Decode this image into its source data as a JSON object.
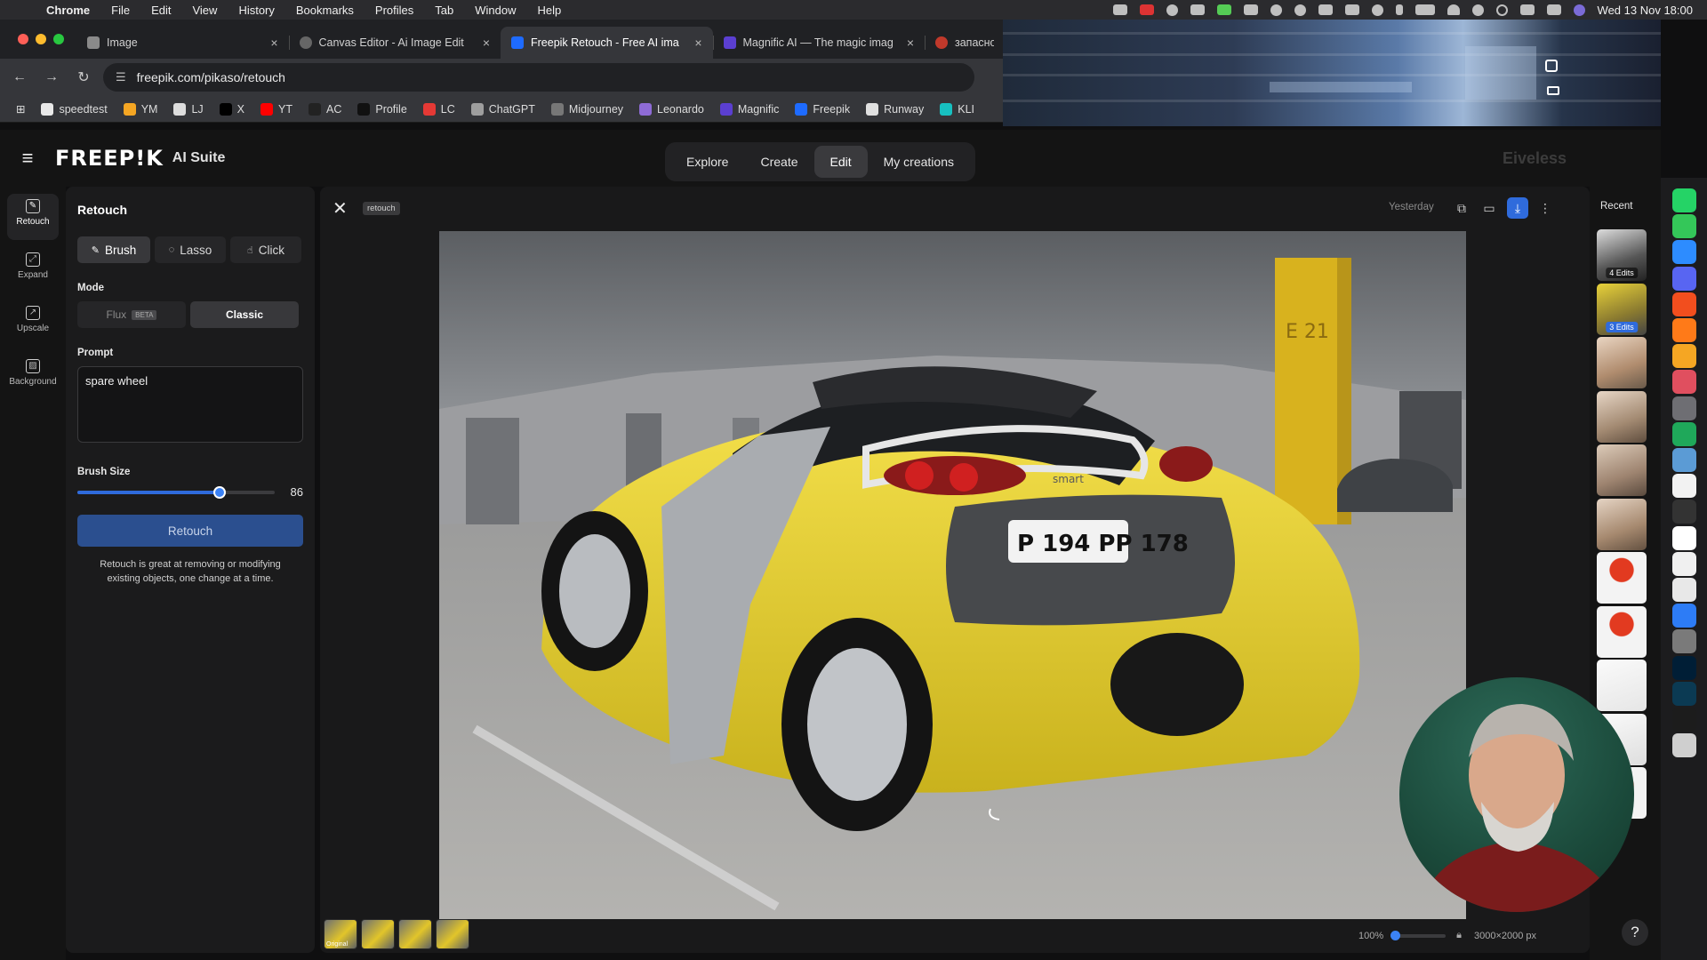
{
  "menubar": {
    "app": "Chrome",
    "items": [
      "File",
      "Edit",
      "View",
      "History",
      "Bookmarks",
      "Profiles",
      "Tab",
      "Window",
      "Help"
    ],
    "clock": "Wed 13 Nov 18:00"
  },
  "tabs": [
    {
      "title": "Image",
      "close": "×",
      "active": false
    },
    {
      "title": "Canvas Editor - Ai Image Edit",
      "close": "×",
      "active": false
    },
    {
      "title": "Freepik Retouch - Free AI ima",
      "close": "×",
      "active": true
    },
    {
      "title": "Magnific AI — The magic imag",
      "close": "×",
      "active": false
    },
    {
      "title": "запасное",
      "close": "",
      "active": false
    }
  ],
  "address": {
    "url": "freepik.com/pikaso/retouch"
  },
  "bookmarks": [
    {
      "label": "speedtest",
      "color": "#e8e8e8"
    },
    {
      "label": "YM",
      "color": "#f5a623"
    },
    {
      "label": "LJ",
      "color": "#dddddd"
    },
    {
      "label": "X",
      "color": "#000000"
    },
    {
      "label": "YT",
      "color": "#ff0000"
    },
    {
      "label": "AC",
      "color": "#222222"
    },
    {
      "label": "Profile",
      "color": "#111111"
    },
    {
      "label": "LC",
      "color": "#e53935"
    },
    {
      "label": "ChatGPT",
      "color": "#9e9e9e"
    },
    {
      "label": "Midjourney",
      "color": "#777777"
    },
    {
      "label": "Leonardo",
      "color": "#8e6bd6"
    },
    {
      "label": "Magnific",
      "color": "#5b3fd1"
    },
    {
      "label": "Freepik",
      "color": "#1e6bff"
    },
    {
      "label": "Runway",
      "color": "#e0e0e0"
    },
    {
      "label": "KLI",
      "color": "#17c0c0"
    }
  ],
  "header": {
    "logo": "FREEP!K",
    "suite": "AI Suite",
    "nav": [
      {
        "label": "Explore",
        "selected": false
      },
      {
        "label": "Create",
        "selected": false
      },
      {
        "label": "Edit",
        "selected": true
      },
      {
        "label": "My creations",
        "selected": false
      }
    ],
    "overlay_text": "Eiveless"
  },
  "rail": [
    {
      "label": "Retouch",
      "selected": true
    },
    {
      "label": "Expand",
      "selected": false
    },
    {
      "label": "Upscale",
      "selected": false
    },
    {
      "label": "Background",
      "selected": false
    }
  ],
  "panel": {
    "title": "Retouch",
    "tools": [
      {
        "label": "Brush",
        "icon": "✎",
        "selected": true
      },
      {
        "label": "Lasso",
        "icon": "◌",
        "selected": false
      },
      {
        "label": "Click",
        "icon": "☝",
        "selected": false
      }
    ],
    "mode_label": "Mode",
    "modes": [
      {
        "label": "Flux",
        "badge": "BETA",
        "selected": false
      },
      {
        "label": "Classic",
        "badge": "",
        "selected": true
      }
    ],
    "prompt_label": "Prompt",
    "prompt_value": "spare wheel",
    "brush_label": "Brush Size",
    "brush_value": "86",
    "brush_fraction": 0.72,
    "action_label": "Retouch",
    "hint": "Retouch is great at removing or modifying existing objects, one change at a time."
  },
  "canvas": {
    "chip": "retouch",
    "timestamp": "Yesterday",
    "zoom": "100%",
    "size": "3000×2000 px",
    "thumb_first_label": "Original",
    "plate": "P 194 PP 178",
    "brand": "smart"
  },
  "recent": {
    "title": "Recent",
    "items": [
      {
        "badge": "4 Edits",
        "style": "dark"
      },
      {
        "badge": "3 Edits",
        "style": "blue"
      },
      {
        "badge": "",
        "style": ""
      },
      {
        "badge": "",
        "style": ""
      },
      {
        "badge": "",
        "style": ""
      },
      {
        "badge": "",
        "style": ""
      },
      {
        "badge": "",
        "style": ""
      },
      {
        "badge": "",
        "style": ""
      },
      {
        "badge": "",
        "style": ""
      },
      {
        "badge": "",
        "style": ""
      },
      {
        "badge": "",
        "style": ""
      }
    ]
  },
  "help": "?"
}
